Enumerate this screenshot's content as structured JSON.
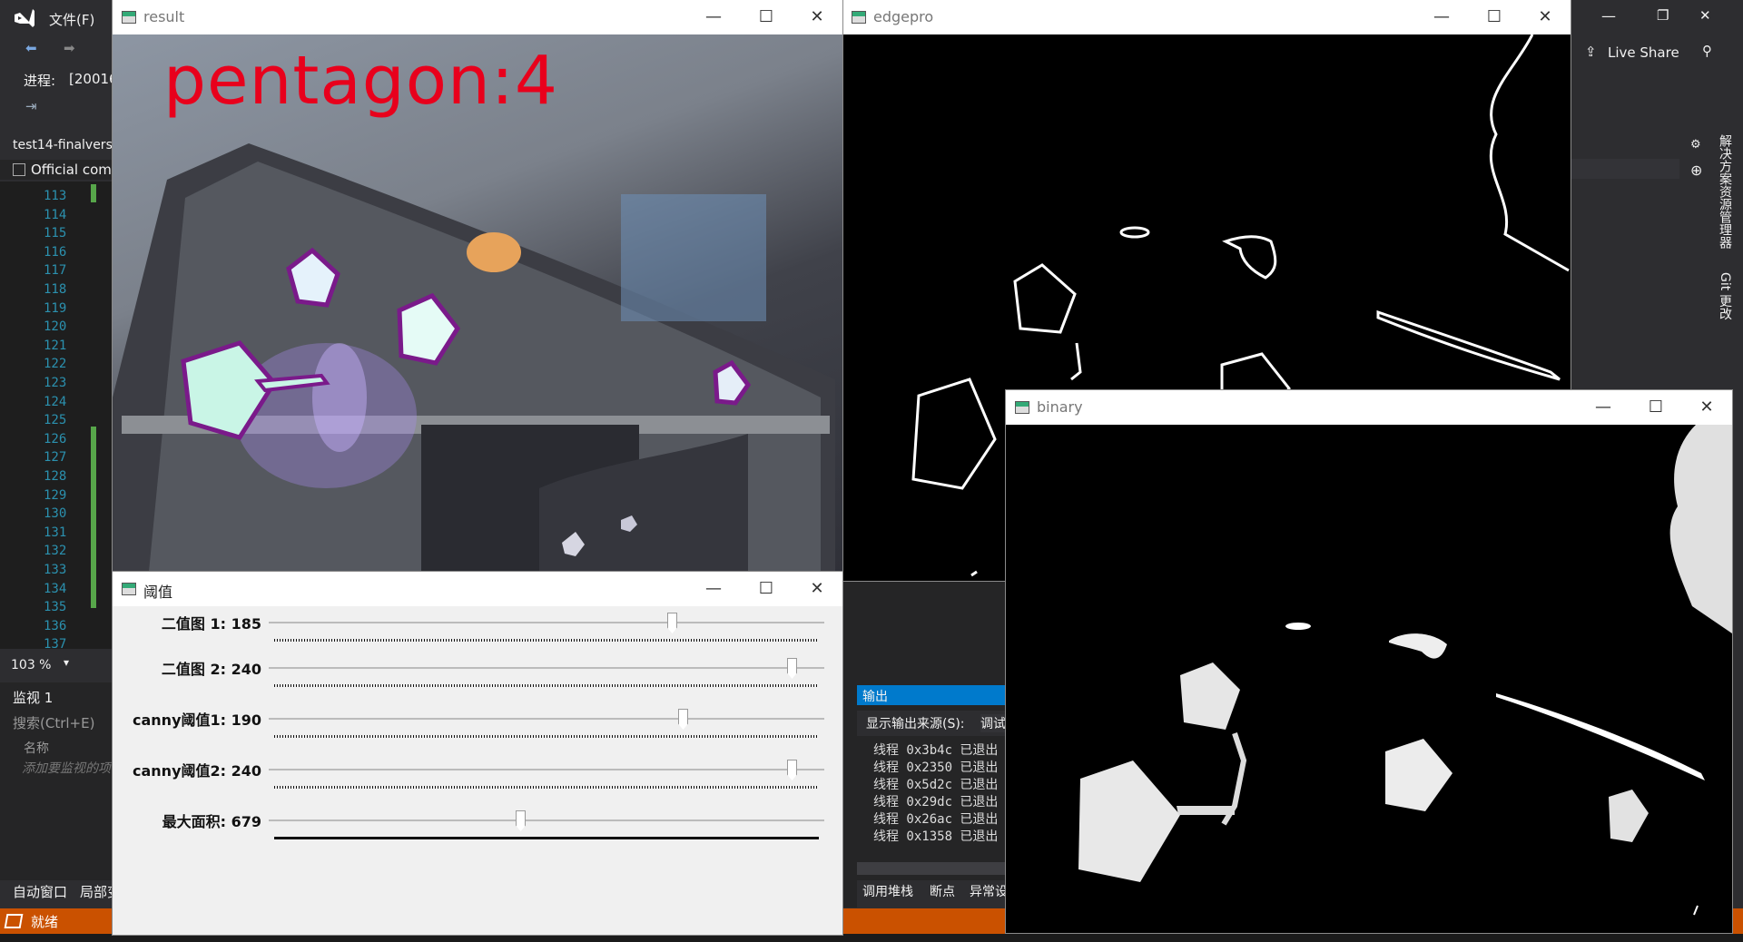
{
  "vs": {
    "menu_file": "文件(F)",
    "process_label": "进程:",
    "process_value": "[20016",
    "solution_tab": "test14-finalvers",
    "scope_combo": "Official comp",
    "line_numbers": [
      "113",
      "114",
      "115",
      "116",
      "117",
      "118",
      "119",
      "120",
      "121",
      "122",
      "123",
      "124",
      "125",
      "126",
      "127",
      "128",
      "129",
      "130",
      "131",
      "132",
      "133",
      "134",
      "135",
      "136",
      "137"
    ],
    "zoom": "103 %",
    "watch_title": "监视 1",
    "watch_search": "搜索(Ctrl+E)",
    "watch_col_name": "名称",
    "watch_add_placeholder": "添加要监视的项",
    "bottom_tab_autos": "自动窗口",
    "bottom_tab_locals": "局部变",
    "status_ready": "就绪",
    "live_share": "Live Share",
    "side_tab_solution": "解决方案资源管理器",
    "side_tab_git": "Git 更改",
    "output_title": "输出",
    "output_source_label": "显示输出来源(S):",
    "output_source_value": "调试",
    "output_lines": [
      "线程 0x3b4c 已退出",
      "线程 0x2350 已退出",
      "线程 0x5d2c 已退出",
      "线程 0x29dc 已退出",
      "线程 0x26ac 已退出",
      "线程 0x1358 已退出"
    ],
    "debug_tabs": [
      "调用堆栈",
      "断点",
      "异常设"
    ]
  },
  "windows": {
    "result": {
      "title": "result",
      "overlay_text": "pentagon:4"
    },
    "edgepro": {
      "title": "edgepro"
    },
    "binary": {
      "title": "binary"
    },
    "threshold": {
      "title": "阈值",
      "trackbars": [
        {
          "label": "二值图 1: 185",
          "value": 185,
          "max": 255
        },
        {
          "label": "二值图 2: 240",
          "value": 240,
          "max": 255
        },
        {
          "label": "canny阈值1: 190",
          "value": 190,
          "max": 255
        },
        {
          "label": "canny阈值2: 240",
          "value": 240,
          "max": 255
        },
        {
          "label": "最大面积: 679",
          "value": 679,
          "max": 1500
        }
      ]
    }
  },
  "window_buttons": {
    "minimize": "—",
    "maximize": "☐",
    "close": "✕"
  },
  "colors": {
    "overlay_text": "#e8001c",
    "contour": "#7a1a8a",
    "status_bar": "#ca5100",
    "output_header": "#007acc"
  }
}
